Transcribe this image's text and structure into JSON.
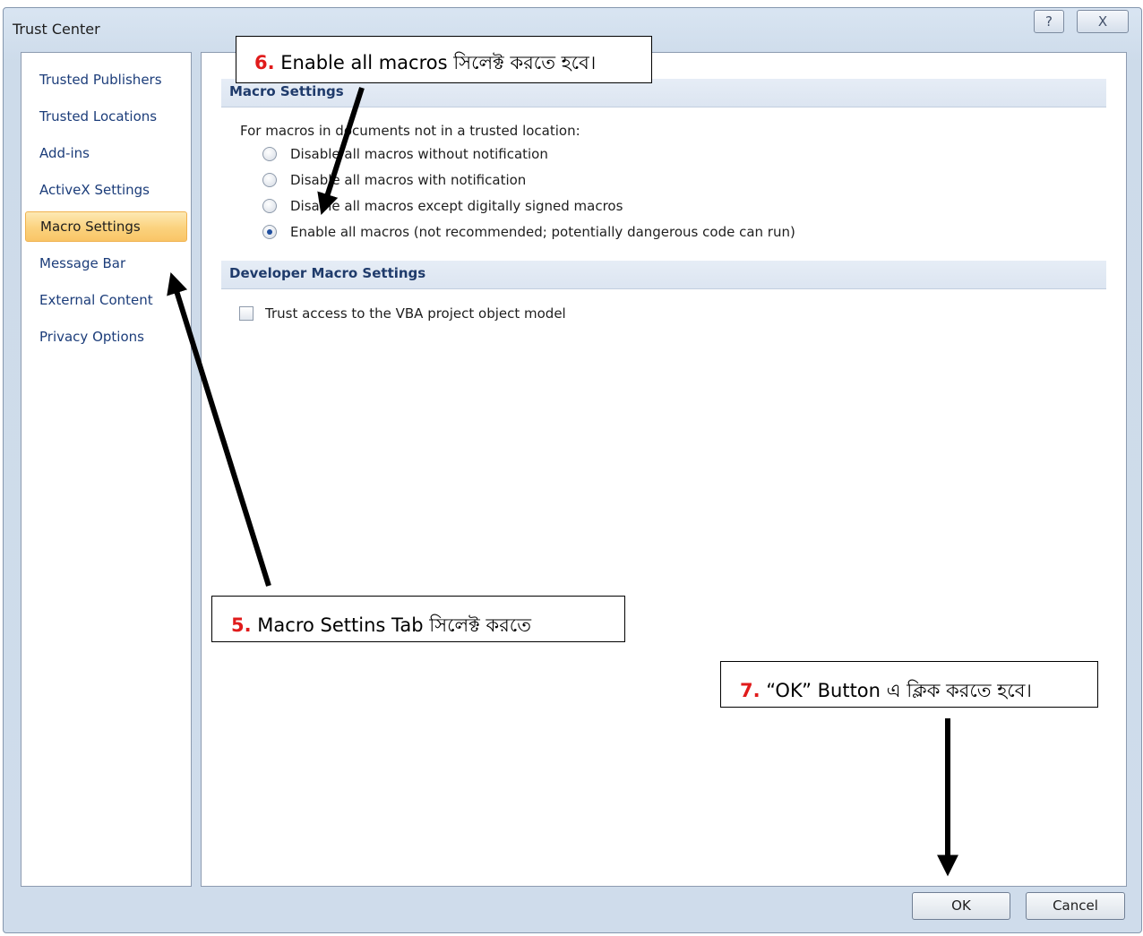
{
  "window": {
    "title": "Trust Center",
    "help_glyph": "?",
    "close_glyph": "X"
  },
  "nav": {
    "items": [
      {
        "label": "Trusted Publishers"
      },
      {
        "label": "Trusted Locations"
      },
      {
        "label": "Add-ins"
      },
      {
        "label": "ActiveX Settings"
      },
      {
        "label": "Macro Settings",
        "active": true
      },
      {
        "label": "Message Bar"
      },
      {
        "label": "External Content"
      },
      {
        "label": "Privacy Options"
      }
    ]
  },
  "macro_settings": {
    "header": "Macro Settings",
    "intro": "For macros in documents not in a trusted location:",
    "options": [
      {
        "label": "Disable all macros without notification",
        "checked": false
      },
      {
        "label": "Disable all macros with notification",
        "checked": false
      },
      {
        "label": "Disable all macros except digitally signed macros",
        "checked": false
      },
      {
        "label": "Enable all macros (not recommended; potentially dangerous code can run)",
        "checked": true
      }
    ]
  },
  "developer_settings": {
    "header": "Developer Macro Settings",
    "trust_vba_label": "Trust access to the VBA project object model",
    "trust_vba_checked": false
  },
  "buttons": {
    "ok": "OK",
    "cancel": "Cancel"
  },
  "callouts": {
    "step6": {
      "num": "6.",
      "text": "Enable all macros সিলেক্ট করতে হবে।"
    },
    "step5": {
      "num": "5.",
      "text": "Macro Settins Tab সিলেক্ট করতে"
    },
    "step7": {
      "num": "7.",
      "text": "“OK” Button এ ক্লিক করতে হবে।"
    }
  },
  "colors": {
    "accent_active": "#fbd27d",
    "callout_number": "#e01b1b",
    "link_text": "#1c3d7a"
  }
}
